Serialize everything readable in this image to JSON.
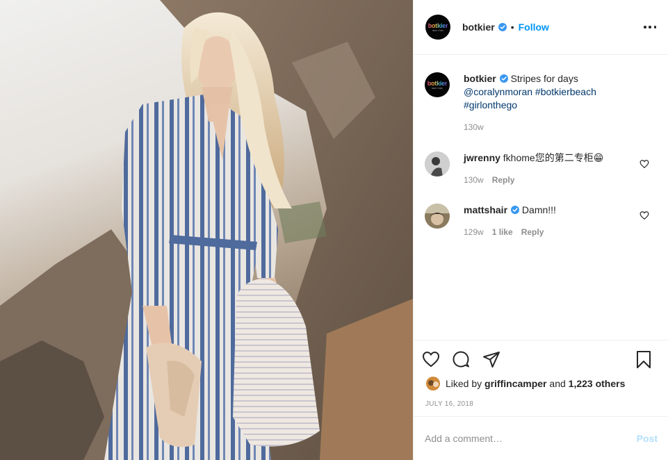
{
  "header": {
    "username": "botkier",
    "verified": true,
    "separator": "•",
    "follow_label": "Follow",
    "brand_wordmark": "botkier",
    "brand_sub": "NEW YORK"
  },
  "caption": {
    "username": "botkier",
    "text": "Stripes for days",
    "mention": "@coralynmoran",
    "hashtags": [
      "#botkierbeach",
      "#girlonthego"
    ],
    "time": "130w"
  },
  "comments": [
    {
      "username": "jwrenny",
      "verified": false,
      "text": "fkhome您的第二专柜😁",
      "time": "130w",
      "likes": "",
      "reply_label": "Reply"
    },
    {
      "username": "mattshair",
      "verified": true,
      "text": "Damn!!!",
      "time": "129w",
      "likes": "1 like",
      "reply_label": "Reply"
    }
  ],
  "actions": {
    "icons": [
      "heart-icon",
      "comment-icon",
      "share-icon",
      "bookmark-icon"
    ]
  },
  "likes": {
    "prefix": "Liked by",
    "user": "griffincamper",
    "conjunction": "and",
    "count": "1,223 others"
  },
  "date": "JULY 16, 2018",
  "add_comment": {
    "placeholder": "Add a comment…",
    "post_label": "Post"
  },
  "colors": {
    "accent": "#0095f6",
    "link": "#00376b",
    "muted": "#8e8e8e",
    "post_disabled": "#b2dffc"
  }
}
